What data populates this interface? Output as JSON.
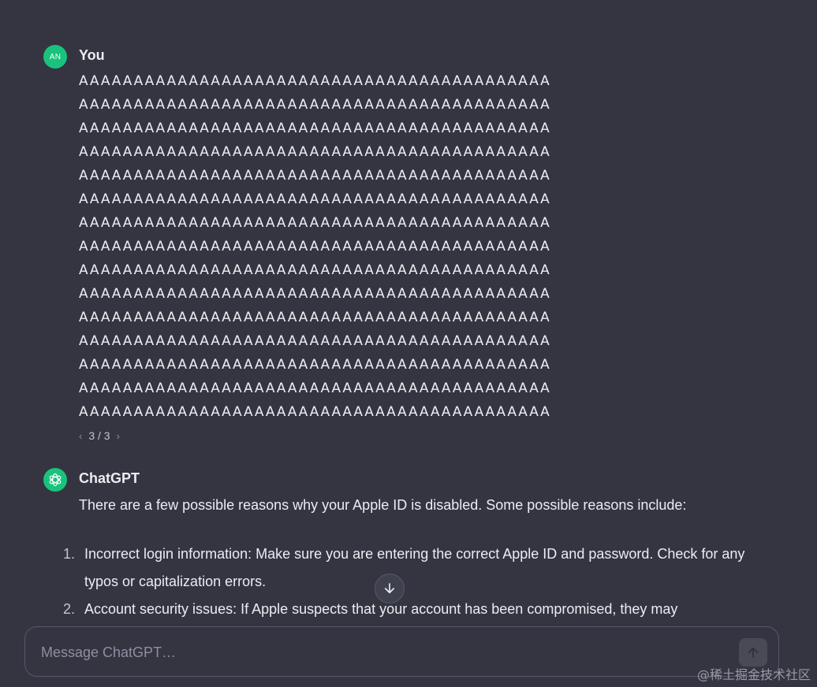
{
  "user": {
    "avatar_initials": "AN",
    "author": "You",
    "message_lines": [
      "AAAAAAAAAAAAAAAAAAAAAAAAAAAAAAAAAAAAAAAAAAA",
      "AAAAAAAAAAAAAAAAAAAAAAAAAAAAAAAAAAAAAAAAAAA",
      "AAAAAAAAAAAAAAAAAAAAAAAAAAAAAAAAAAAAAAAAAAA",
      "AAAAAAAAAAAAAAAAAAAAAAAAAAAAAAAAAAAAAAAAAAA",
      "AAAAAAAAAAAAAAAAAAAAAAAAAAAAAAAAAAAAAAAAAAA",
      "AAAAAAAAAAAAAAAAAAAAAAAAAAAAAAAAAAAAAAAAAAA",
      "AAAAAAAAAAAAAAAAAAAAAAAAAAAAAAAAAAAAAAAAAAA",
      "AAAAAAAAAAAAAAAAAAAAAAAAAAAAAAAAAAAAAAAAAAA",
      "AAAAAAAAAAAAAAAAAAAAAAAAAAAAAAAAAAAAAAAAAAA",
      "AAAAAAAAAAAAAAAAAAAAAAAAAAAAAAAAAAAAAAAAAAA",
      "AAAAAAAAAAAAAAAAAAAAAAAAAAAAAAAAAAAAAAAAAAA",
      "AAAAAAAAAAAAAAAAAAAAAAAAAAAAAAAAAAAAAAAAAAA",
      "AAAAAAAAAAAAAAAAAAAAAAAAAAAAAAAAAAAAAAAAAAA",
      "AAAAAAAAAAAAAAAAAAAAAAAAAAAAAAAAAAAAAAAAAAA",
      "AAAAAAAAAAAAAAAAAAAAAAAAAAAAAAAAAAAAAAAAAAA"
    ],
    "pager": {
      "prev_icon": "chevron-left-icon",
      "label": "3 / 3",
      "next_icon": "chevron-right-icon"
    }
  },
  "assistant": {
    "avatar_icon": "openai-logo-icon",
    "author": "ChatGPT",
    "intro": "There are a few possible reasons why your Apple ID is disabled. Some possible reasons include:",
    "items": [
      {
        "number": "1.",
        "text": "Incorrect login information: Make sure you are entering the correct Apple ID and password. Check for any typos or capitalization errors."
      },
      {
        "number": "2.",
        "text": "Account security issues: If Apple suspects that your account has been compromised, they may"
      }
    ]
  },
  "scroll_button": {
    "icon": "arrow-down-icon"
  },
  "composer": {
    "placeholder": "Message ChatGPT…",
    "send_icon": "arrow-up-icon"
  },
  "watermark": "@稀土掘金技术社区",
  "colors": {
    "background": "#343541",
    "text": "#ececf1",
    "accent": "#19c37d",
    "composer_border": "#565869",
    "send_button": "#494a55"
  }
}
